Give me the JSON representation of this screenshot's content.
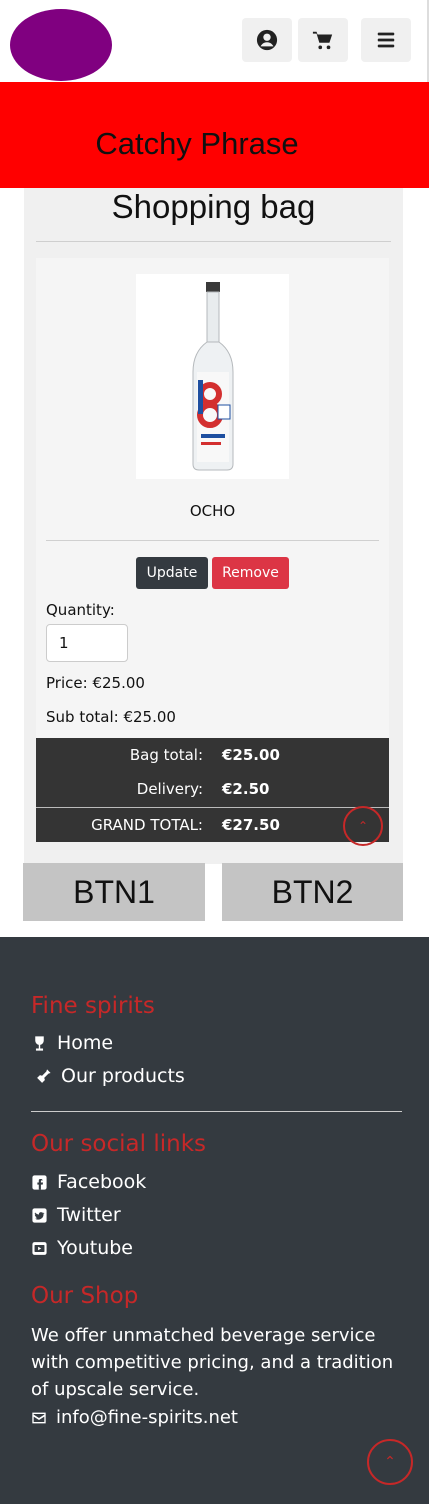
{
  "header": {
    "logo_color": "#800080",
    "icons": [
      "user-circle-icon",
      "cart-icon",
      "menu-icon"
    ]
  },
  "banner": {
    "text": "Catchy Phrase",
    "color": "#ff0000"
  },
  "bag": {
    "title": "Shopping bag",
    "item": {
      "name": "OCHO",
      "image_icon": "tequila-bottle-image",
      "update_label": "Update",
      "remove_label": "Remove",
      "quantity_label": "Quantity:",
      "quantity_value": "1",
      "price_label": "Price:",
      "price_value": "€25.00",
      "subtotal_label": "Sub total:",
      "subtotal_value": "€25.00"
    },
    "totals": {
      "bag_total_label": "Bag total:",
      "bag_total_value": "€25.00",
      "delivery_label": "Delivery:",
      "delivery_value": "€2.50",
      "grand_total_label": "GRAND TOTAL:",
      "grand_total_value": "€27.50"
    }
  },
  "actions": {
    "btn1_label": "BTN1",
    "btn2_label": "BTN2"
  },
  "footer": {
    "section1_title": "Fine spirits",
    "links": [
      {
        "label": "Home",
        "icon": "wine-glass-icon"
      },
      {
        "label": "Our products",
        "icon": "bottle-icon"
      }
    ],
    "section2_title": "Our social links",
    "social": [
      {
        "label": "Facebook",
        "icon": "facebook-icon"
      },
      {
        "label": "Twitter",
        "icon": "twitter-icon"
      },
      {
        "label": "Youtube",
        "icon": "youtube-icon"
      }
    ],
    "section3_title": "Our Shop",
    "description": "We offer unmatched beverage service with competitive pricing, and a tradition of upscale service.",
    "email": "info@fine-spirits.net",
    "accent_color": "#c62828"
  }
}
